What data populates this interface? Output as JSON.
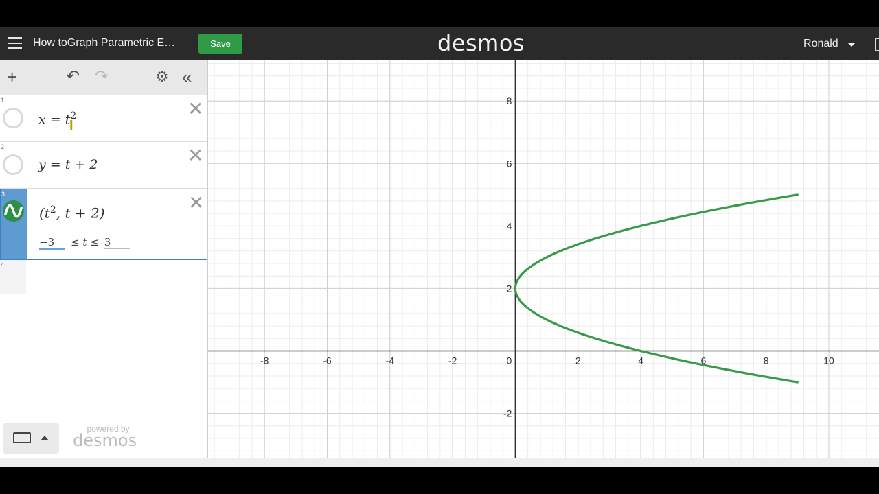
{
  "header": {
    "document_title": "How toGraph Parametric E…",
    "save_label": "Save",
    "logo": "desmos",
    "user_name": "Ronald"
  },
  "expressions": [
    {
      "number": "1",
      "latex_text": "x = t²",
      "base": "x = t",
      "exp": "2"
    },
    {
      "number": "2",
      "latex_text": "y = t + 2",
      "text": "y = t + 2"
    },
    {
      "number": "3",
      "latex_text": "(t², t + 2)",
      "open": "(t",
      "exp": "2",
      "rest": ", t + 2)",
      "range_min": "−3",
      "range_mid": "≤ t ≤",
      "range_max": "3",
      "active": true
    },
    {
      "number": "4"
    }
  ],
  "footer": {
    "powered_by": "powered by",
    "brand": "desmos"
  },
  "colors": {
    "header_bg": "#2a2a2a",
    "save_green": "#2f9b46",
    "curve_green": "#3a9a4a",
    "active_blue": "#5e9bd1"
  },
  "icons": [
    "hamburger-icon",
    "plus-icon",
    "undo-icon",
    "redo-icon",
    "gear-icon",
    "collapse-icon",
    "close-icon",
    "keyboard-icon",
    "caret-up-icon",
    "caret-down-icon"
  ],
  "chart_data": {
    "type": "line",
    "x_ticks": [
      "-8",
      "-6",
      "-4",
      "-2",
      "0",
      "2",
      "4",
      "6",
      "8",
      "10"
    ],
    "y_ticks": [
      "8",
      "6",
      "4",
      "2",
      "-2"
    ],
    "xlim": [
      -9.8,
      11.6
    ],
    "ylim": [
      -3.7,
      9.3
    ],
    "grid": true,
    "series": [
      {
        "parametric": "(t^2, t+2)",
        "t_range": [
          -3,
          3
        ],
        "x": [
          9,
          6.25,
          4,
          2.25,
          1,
          0.25,
          0,
          0.25,
          1,
          2.25,
          4,
          6.25,
          9
        ],
        "y": [
          -1,
          -0.5,
          0,
          0.5,
          1,
          1.5,
          2,
          2.5,
          3,
          3.5,
          4,
          4.5,
          5
        ]
      }
    ]
  }
}
